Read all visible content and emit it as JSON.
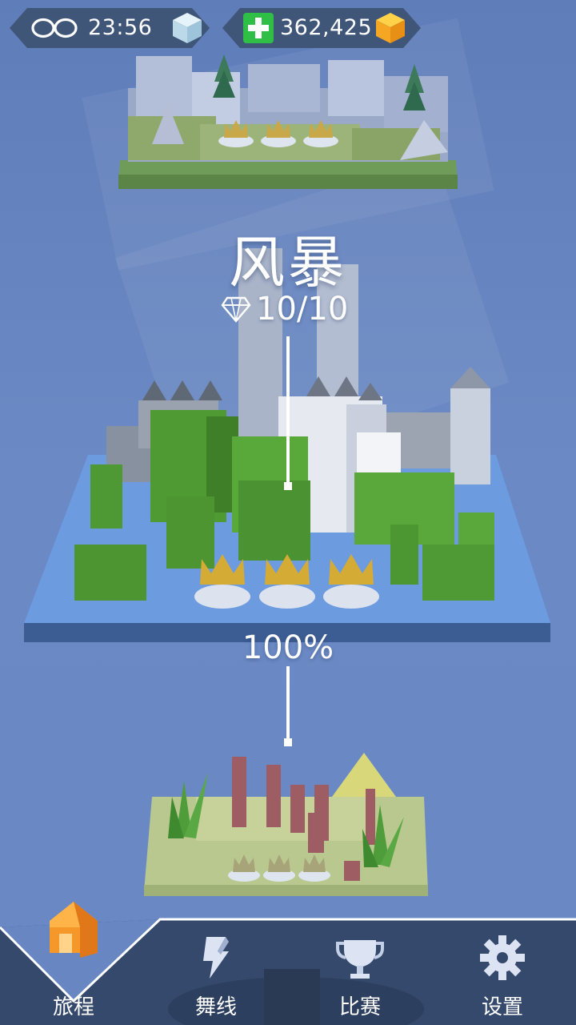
{
  "hud": {
    "lives_icon": "infinity-icon",
    "timer": "23:56",
    "timer_icon": "ice-cube-icon",
    "gems_plus_icon": "plus-icon",
    "gems": "362,425",
    "gems_icon": "gold-cube-icon"
  },
  "current_level": {
    "title": "风暴",
    "diamonds": "10/10",
    "diamond_icon": "diamond-icon",
    "progress_text": "100%",
    "crowns": 3
  },
  "levels": {
    "previous_crowns": 3,
    "next_crowns": 3
  },
  "nav": {
    "items": [
      {
        "label": "旅程",
        "icon": "house-icon",
        "active": true
      },
      {
        "label": "舞线",
        "icon": "line-icon",
        "active": false
      },
      {
        "label": "比赛",
        "icon": "trophy-icon",
        "active": false
      },
      {
        "label": "设置",
        "icon": "gear-icon",
        "active": false
      }
    ]
  },
  "colors": {
    "background": "#6583bf",
    "hud": "#3f5679",
    "nav": "#34496b",
    "accent_orange": "#f6972a",
    "grass": "#5ca83c",
    "plus": "#2fbf46"
  }
}
